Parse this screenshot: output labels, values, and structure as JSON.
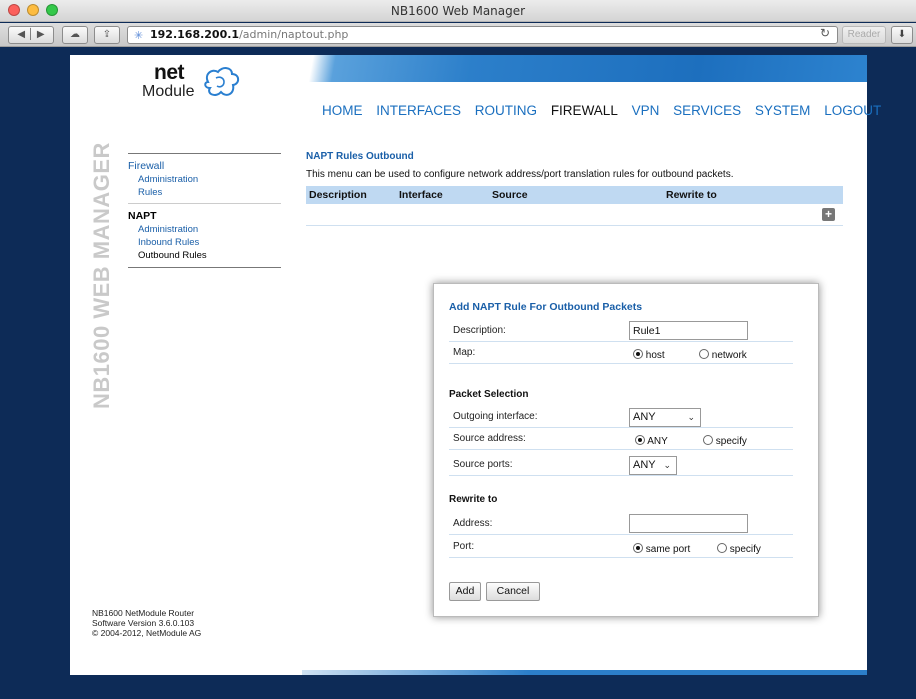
{
  "window": {
    "title": "NB1600 Web Manager"
  },
  "browser": {
    "url_host": "192.168.200.1",
    "url_path": "/admin/naptout.php",
    "reader_label": "Reader",
    "reload_icon": "reload-icon",
    "back_icon": "back-icon",
    "forward_icon": "forward-icon"
  },
  "branding": {
    "logo_top": "net",
    "logo_bottom": "Module",
    "vertical_title": "NB1600 WEB MANAGER"
  },
  "topnav": {
    "items": [
      "HOME",
      "INTERFACES",
      "ROUTING",
      "FIREWALL",
      "VPN",
      "SERVICES",
      "SYSTEM",
      "LOGOUT"
    ],
    "active": "FIREWALL"
  },
  "sidebar": {
    "firewall_label": "Firewall",
    "firewall_items": [
      "Administration",
      "Rules"
    ],
    "napt_label": "NAPT",
    "napt_items": [
      "Administration",
      "Inbound Rules",
      "Outbound Rules"
    ],
    "current": "Outbound Rules"
  },
  "footer": {
    "line1": "NB1600 NetModule Router",
    "line2": "Software Version 3.6.0.103",
    "line3": "© 2004-2012, NetModule AG"
  },
  "main": {
    "section_title": "NAPT Rules Outbound",
    "description": "This menu can be used to configure network address/port translation rules for outbound packets.",
    "table_headers": [
      "Description",
      "Interface",
      "Source",
      "Rewrite to"
    ]
  },
  "dialog": {
    "title": "Add NAPT Rule For Outbound Packets",
    "description_label": "Description:",
    "description_value": "Rule1",
    "map_label": "Map:",
    "map_options": [
      "host",
      "network"
    ],
    "map_selected": "host",
    "packet_selection_heading": "Packet Selection",
    "outgoing_interface_label": "Outgoing interface:",
    "outgoing_interface_value": "ANY",
    "source_address_label": "Source address:",
    "source_address_options": [
      "ANY",
      "specify"
    ],
    "source_address_selected": "ANY",
    "source_ports_label": "Source ports:",
    "source_ports_value": "ANY",
    "rewrite_heading": "Rewrite to",
    "address_label": "Address:",
    "address_value": "",
    "port_label": "Port:",
    "port_options": [
      "same port",
      "specify"
    ],
    "port_selected": "same port",
    "add_button": "Add",
    "cancel_button": "Cancel"
  },
  "colors": {
    "page_background": "#0d2b57",
    "accent_blue": "#1a6fbf",
    "table_header": "#bfd9f2"
  }
}
